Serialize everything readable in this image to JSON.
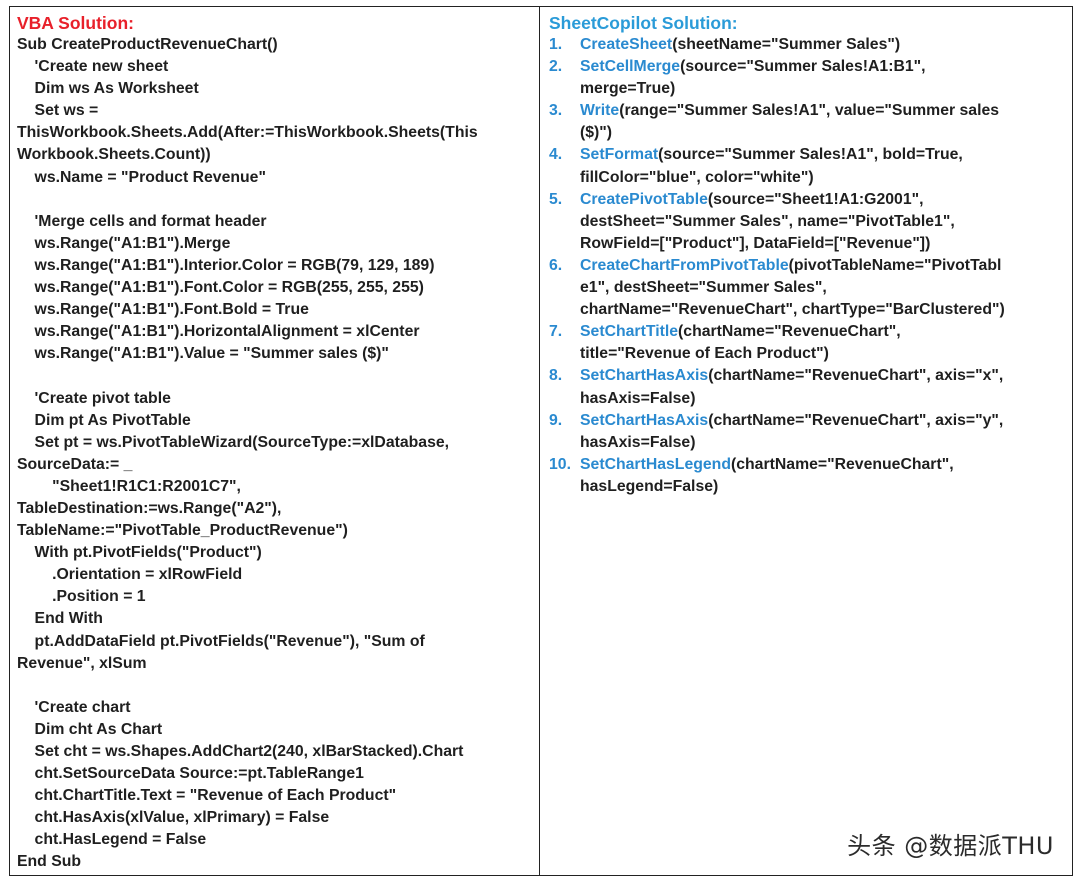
{
  "vba": {
    "title": "VBA Solution:",
    "lines": [
      "Sub CreateProductRevenueChart()",
      "    'Create new sheet",
      "    Dim ws As Worksheet",
      "    Set ws =",
      "ThisWorkbook.Sheets.Add(After:=ThisWorkbook.Sheets(This",
      "Workbook.Sheets.Count))",
      "    ws.Name = \"Product Revenue\"",
      "",
      "    'Merge cells and format header",
      "    ws.Range(\"A1:B1\").Merge",
      "    ws.Range(\"A1:B1\").Interior.Color = RGB(79, 129, 189)",
      "    ws.Range(\"A1:B1\").Font.Color = RGB(255, 255, 255)",
      "    ws.Range(\"A1:B1\").Font.Bold = True",
      "    ws.Range(\"A1:B1\").HorizontalAlignment = xlCenter",
      "    ws.Range(\"A1:B1\").Value = \"Summer sales ($)\"",
      "",
      "    'Create pivot table",
      "    Dim pt As PivotTable",
      "    Set pt = ws.PivotTableWizard(SourceType:=xlDatabase,",
      "SourceData:= _",
      "        \"Sheet1!R1C1:R2001C7\",",
      "TableDestination:=ws.Range(\"A2\"),",
      "TableName:=\"PivotTable_ProductRevenue\")",
      "    With pt.PivotFields(\"Product\")",
      "        .Orientation = xlRowField",
      "        .Position = 1",
      "    End With",
      "    pt.AddDataField pt.PivotFields(\"Revenue\"), \"Sum of",
      "Revenue\", xlSum",
      "",
      "    'Create chart",
      "    Dim cht As Chart",
      "    Set cht = ws.Shapes.AddChart2(240, xlBarStacked).Chart",
      "    cht.SetSourceData Source:=pt.TableRange1",
      "    cht.ChartTitle.Text = \"Revenue of Each Product\"",
      "    cht.HasAxis(xlValue, xlPrimary) = False",
      "    cht.HasLegend = False",
      "End Sub"
    ]
  },
  "sheetcopilot": {
    "title": "SheetCopilot Solution:",
    "steps": [
      {
        "num": "1.",
        "fn": "CreateSheet",
        "lines": [
          "(sheetName=\"Summer Sales\")"
        ]
      },
      {
        "num": "2.",
        "fn": "SetCellMerge",
        "lines": [
          "(source=\"Summer Sales!A1:B1\",",
          "merge=True)"
        ]
      },
      {
        "num": "3.",
        "fn": "Write",
        "lines": [
          "(range=\"Summer Sales!A1\", value=\"Summer sales",
          "($)\")"
        ]
      },
      {
        "num": "4.",
        "fn": "SetFormat",
        "lines": [
          "(source=\"Summer Sales!A1\", bold=True,",
          "fillColor=\"blue\", color=\"white\")"
        ]
      },
      {
        "num": "5.",
        "fn": "CreatePivotTable",
        "lines": [
          "(source=\"Sheet1!A1:G2001\",",
          "destSheet=\"Summer Sales\", name=\"PivotTable1\",",
          "RowField=[\"Product\"], DataField=[\"Revenue\"])"
        ]
      },
      {
        "num": "6.",
        "fn": "CreateChartFromPivotTable",
        "lines": [
          "(pivotTableName=\"PivotTabl",
          "e1\", destSheet=\"Summer Sales\",",
          "chartName=\"RevenueChart\", chartType=\"BarClustered\")"
        ]
      },
      {
        "num": "7.",
        "fn": "SetChartTitle",
        "lines": [
          "(chartName=\"RevenueChart\",",
          "title=\"Revenue of Each Product\")"
        ]
      },
      {
        "num": "8.",
        "fn": "SetChartHasAxis",
        "lines": [
          "(chartName=\"RevenueChart\", axis=\"x\",",
          "hasAxis=False)"
        ]
      },
      {
        "num": "9.",
        "fn": "SetChartHasAxis",
        "lines": [
          "(chartName=\"RevenueChart\", axis=\"y\",",
          "hasAxis=False)"
        ]
      },
      {
        "num": "10.",
        "fn": "SetChartHasLegend",
        "lines": [
          "(chartName=\"RevenueChart\",",
          "hasLegend=False)"
        ]
      }
    ]
  },
  "watermark": "头条 @数据派THU",
  "colors": {
    "vba_title": "#e8202a",
    "sheetcopilot_title": "#2a9bd8",
    "function_name": "#2a8ad0"
  }
}
